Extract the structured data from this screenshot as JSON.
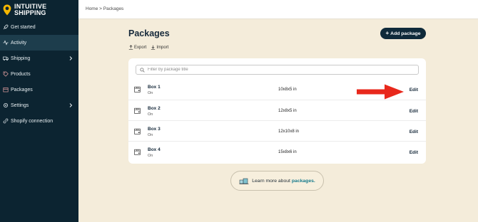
{
  "brand": {
    "line1": "INTUITIVE",
    "line2": "SHIPPING"
  },
  "sidebar": {
    "items": [
      {
        "label": "Get started",
        "icon": "rocket-icon",
        "has_chevron": false
      },
      {
        "label": "Activity",
        "icon": "activity-icon",
        "has_chevron": false,
        "active": true
      },
      {
        "label": "Shipping",
        "icon": "truck-icon",
        "has_chevron": true
      },
      {
        "label": "Products",
        "icon": "tag-icon",
        "has_chevron": false
      },
      {
        "label": "Packages",
        "icon": "box-icon",
        "has_chevron": false
      },
      {
        "label": "Settings",
        "icon": "gear-icon",
        "has_chevron": true
      },
      {
        "label": "Shopify connection",
        "icon": "link-icon",
        "has_chevron": false
      }
    ]
  },
  "breadcrumb": {
    "home": "Home",
    "separator": ">",
    "current": "Packages"
  },
  "page": {
    "title": "Packages",
    "add_button": "Add package",
    "export_label": "Export",
    "import_label": "Import",
    "search_placeholder": "Filter by package title"
  },
  "packages": [
    {
      "title": "Box 1",
      "status": "On",
      "dims": "10x8x5 in",
      "edit": "Edit"
    },
    {
      "title": "Box 2",
      "status": "On",
      "dims": "12x8x5 in",
      "edit": "Edit"
    },
    {
      "title": "Box 3",
      "status": "On",
      "dims": "12x10x8 in",
      "edit": "Edit"
    },
    {
      "title": "Box 4",
      "status": "On",
      "dims": "15x8x6 in",
      "edit": "Edit"
    }
  ],
  "learn_more": {
    "prefix": "Learn more about",
    "link": "packages."
  },
  "colors": {
    "sidebar_bg": "#0c2431",
    "page_bg": "#f4ecda",
    "accent": "#f5b700",
    "arrow": "#e8281c",
    "link": "#167a8c"
  }
}
